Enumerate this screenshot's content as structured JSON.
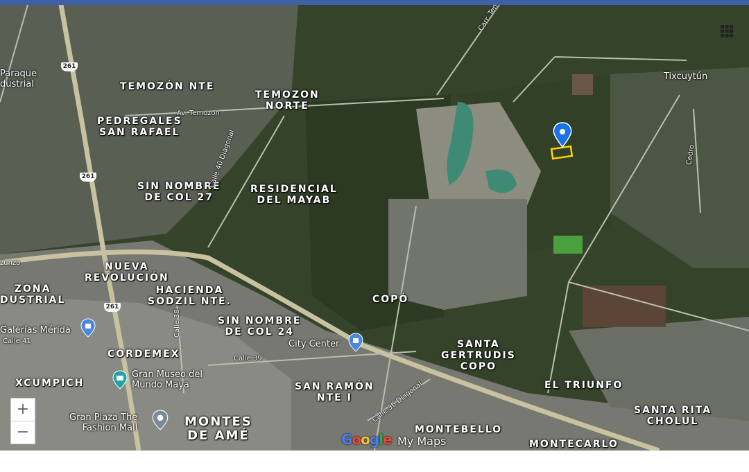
{
  "colors": {
    "topbar": "#3f5fa7",
    "marker": "#1a73e8",
    "parcel_outline": "#ffd400",
    "vegetation": "#34432a"
  },
  "map": {
    "neighborhoods": [
      {
        "id": "temozon-nte",
        "text": "TEMOZÓN NTE"
      },
      {
        "id": "temozon-norte",
        "text": "TEMOZON\nNORTE"
      },
      {
        "id": "pedregales",
        "text": "PEDREGALES\nSAN RAFAEL"
      },
      {
        "id": "sin-nombre-27",
        "text": "SIN NOMBRE\nDE COL 27"
      },
      {
        "id": "residencial-mayab",
        "text": "RESIDENCIAL\nDEL MAYAB"
      },
      {
        "id": "nueva-revolucion",
        "text": "NUEVA\nREVOLUCIÓN"
      },
      {
        "id": "zona-industrial",
        "text": "ZONA\nDUSTRIAL"
      },
      {
        "id": "hacienda-sodzil",
        "text": "HACIENDA\nSODZIL NTE."
      },
      {
        "id": "copo",
        "text": "COPÓ"
      },
      {
        "id": "sin-nombre-24",
        "text": "SIN NOMBRE\nDE COL 24"
      },
      {
        "id": "cordemex",
        "text": "CORDEMEX"
      },
      {
        "id": "santa-gertrudis",
        "text": "SANTA\nGERTRUDIS\nCOPO"
      },
      {
        "id": "xcumpich",
        "text": "XCUMPICH"
      },
      {
        "id": "san-ramon",
        "text": "SAN RAMÓN\nNTE I"
      },
      {
        "id": "el-triunfo",
        "text": "EL TRIUNFO"
      },
      {
        "id": "santa-rita",
        "text": "SANTA RITA\nCHOLUL"
      },
      {
        "id": "montes-de-ame",
        "text": "MONTES\nDE AMÉ"
      },
      {
        "id": "montebello",
        "text": "MONTEBELLO"
      },
      {
        "id": "montecarlo",
        "text": "MONTECARLO"
      }
    ],
    "places": [
      {
        "id": "paraque",
        "text": "Paraque\ndustrial"
      },
      {
        "id": "tixcuytun",
        "text": "Tixcuytún"
      },
      {
        "id": "galerias",
        "text": "Galerías Mérida"
      },
      {
        "id": "city-center",
        "text": "City Center"
      },
      {
        "id": "gran-museo",
        "text": "Gran Museo del\nMundo Maya"
      },
      {
        "id": "gran-plaza",
        "text": "Gran Plaza The\nFashion Mall"
      }
    ],
    "roads": [
      {
        "id": "av-temozon",
        "text": "Av. Temozon"
      },
      {
        "id": "calle-40",
        "text": "Calle 40 Diagonal"
      },
      {
        "id": "carr-tem",
        "text": "Carr. Tem"
      },
      {
        "id": "cedro",
        "text": "Cedro"
      },
      {
        "id": "calle-41",
        "text": "Calle 41"
      },
      {
        "id": "calle-39",
        "text": "Calle 39"
      },
      {
        "id": "calle-38",
        "text": "Calle 38"
      },
      {
        "id": "calle-36",
        "text": "Calle 36 Diagonal"
      },
      {
        "id": "zunza",
        "text": "zunza"
      }
    ],
    "highway_shields": [
      "261",
      "261",
      "261"
    ],
    "controls": {
      "zoom_in": "+",
      "zoom_out": "−"
    },
    "attribution": {
      "google": "Google",
      "suffix": "My Maps"
    }
  }
}
